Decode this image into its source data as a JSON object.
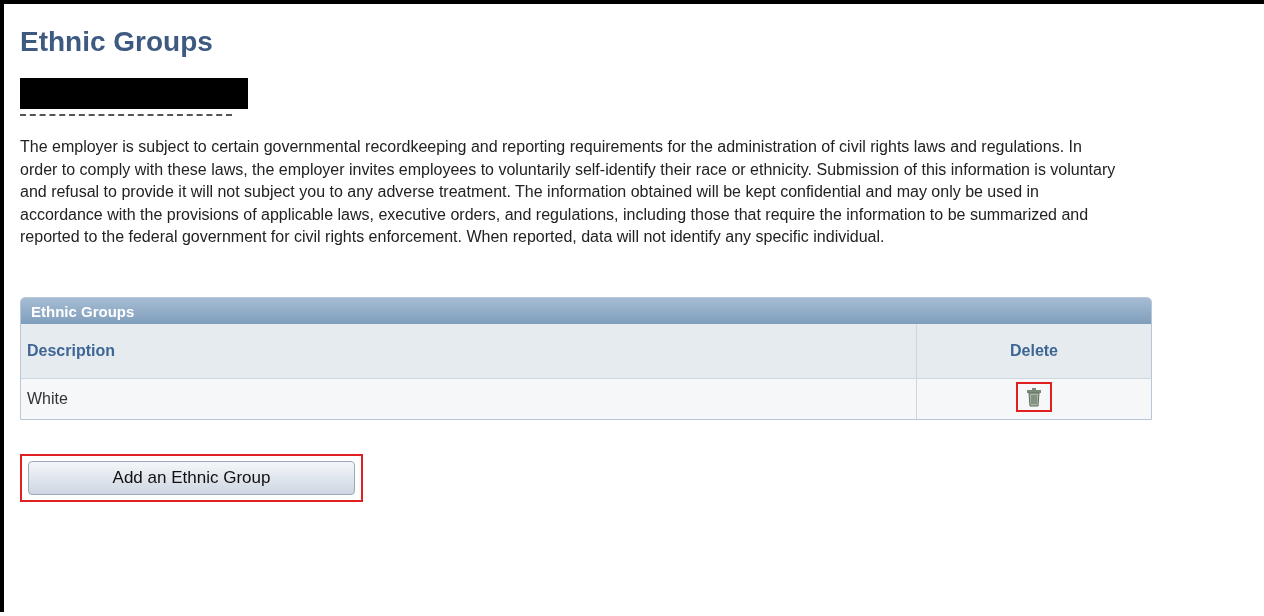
{
  "page": {
    "title": "Ethnic Groups"
  },
  "notice": "The employer is subject to certain governmental recordkeeping and reporting requirements for the administration of civil rights laws and regulations. In order to comply with these laws, the employer invites employees to voluntarily self-identify their race or ethnicity. Submission of this information is voluntary and refusal to provide it will not subject you to any adverse treatment. The information obtained will be kept confidential and may only be used in accordance with the provisions of applicable laws, executive orders, and regulations, including those that require the information to be summarized and reported to the federal government for civil rights enforcement. When reported, data will not identify any specific individual.",
  "grid": {
    "title": "Ethnic Groups",
    "columns": [
      "Description",
      "Delete"
    ],
    "rows": [
      {
        "description": "White",
        "delete_highlighted": true
      }
    ]
  },
  "add_button": {
    "label": "Add an Ethnic Group",
    "highlighted": true
  }
}
